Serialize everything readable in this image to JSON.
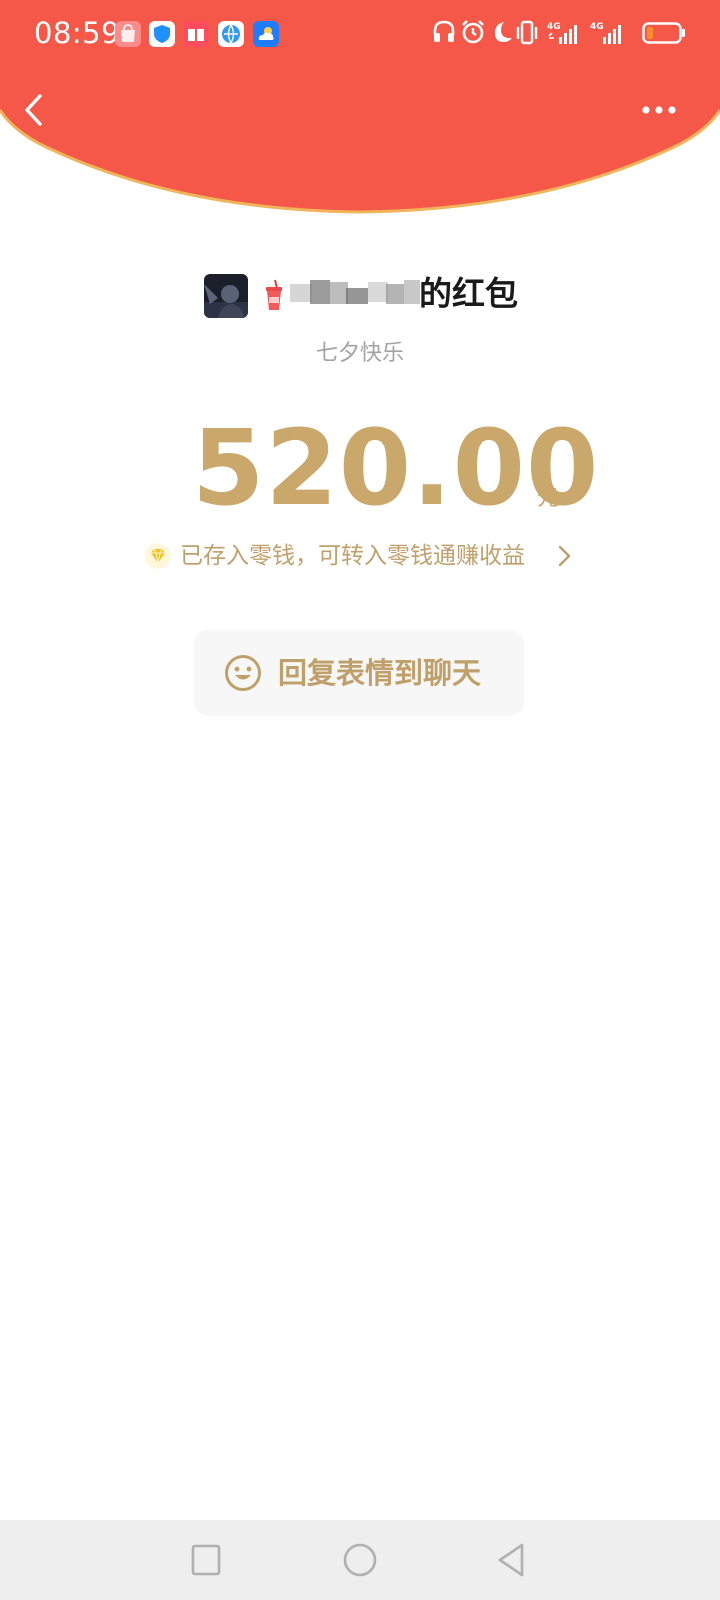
{
  "status_bar": {
    "time": "08:59",
    "app_icons": [
      "shopping-bag-icon",
      "shield-icon",
      "book-icon",
      "browser-icon",
      "weather-icon"
    ],
    "system_icons": [
      "headphones-icon",
      "alarm-icon",
      "do-not-disturb-icon",
      "vibrate-icon",
      "signal-4g-icon",
      "signal-4g-icon",
      "battery-icon"
    ],
    "network_label_1": "4G",
    "network_label_2": "4G",
    "battery_level": 0.2
  },
  "header": {
    "background_color": "#f55749",
    "back_icon": "chevron-left-icon",
    "more_icon": "more-horizontal-icon"
  },
  "sender": {
    "suffix": "的红包"
  },
  "wish_text": "七夕快乐",
  "amount": {
    "value": "520.00",
    "unit": "元"
  },
  "notice": {
    "text": "已存入零钱，可转入零钱通赚收益",
    "icon": "diamond-icon"
  },
  "reply": {
    "label": "回复表情到聊天",
    "icon": "smile-icon"
  },
  "nav_bar": {
    "buttons": [
      "recent-apps-icon",
      "home-icon",
      "back-triangle-icon"
    ]
  }
}
